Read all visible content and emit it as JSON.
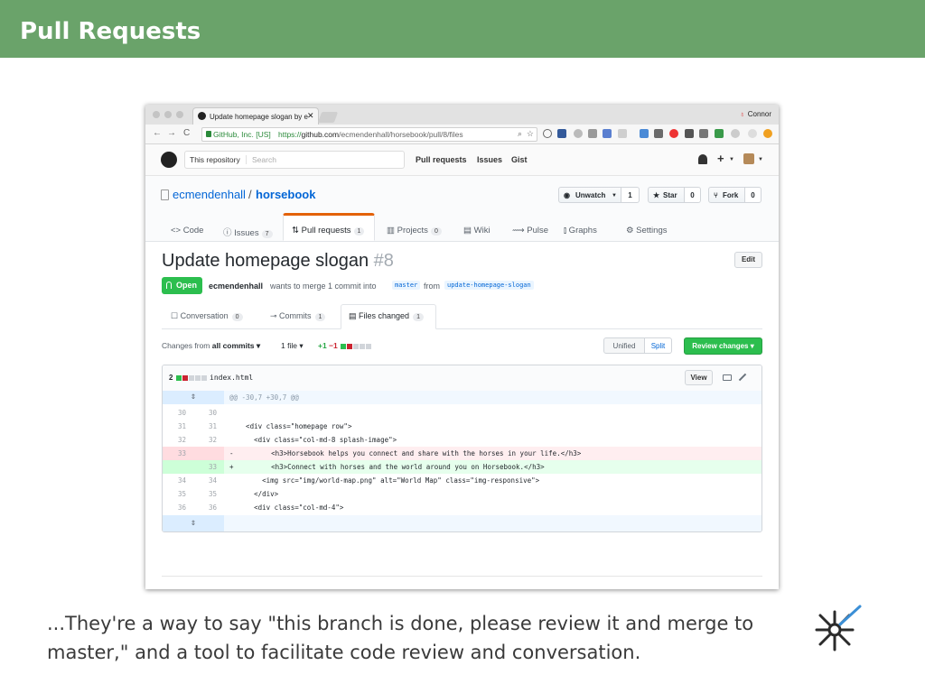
{
  "slide": {
    "title": "Pull Requests",
    "caption": "...They're a way to say \"this branch is done, please review it and merge to master,\" and a tool to facilitate code review and conversation."
  },
  "browser": {
    "tab_title": "Update homepage slogan by e",
    "tab_close": "✕",
    "user_name": "Connor",
    "back": "←",
    "forward": "→",
    "reload": "C",
    "secure_label": "GitHub, Inc. [US]",
    "url_scheme": "https://",
    "url_host": "github.com",
    "url_path": "/ecmendenhall/horsebook/pull/8/files"
  },
  "github": {
    "scope_label": "This repository",
    "search_placeholder": "Search",
    "nav": [
      "Pull requests",
      "Issues",
      "Gist"
    ],
    "plus": "+"
  },
  "repo": {
    "owner": "ecmendenhall",
    "separator": "/",
    "name": "horsebook",
    "watch_label": "Unwatch",
    "watch_count": "1",
    "star_label": "Star",
    "star_count": "0",
    "fork_label": "Fork",
    "fork_count": "0",
    "tabs": [
      {
        "label": "<> Code",
        "count": ""
      },
      {
        "label": "ⓘ Issues",
        "count": "7"
      },
      {
        "label": "Pull requests",
        "count": "1"
      },
      {
        "label": "▥ Projects",
        "count": "0"
      },
      {
        "label": "▤ Wiki",
        "count": ""
      },
      {
        "label": "⟿ Pulse",
        "count": ""
      },
      {
        "label": "⫾ Graphs",
        "count": ""
      },
      {
        "label": "⚙ Settings",
        "count": ""
      }
    ]
  },
  "pr": {
    "title": "Update homepage slogan",
    "number": "#8",
    "edit_label": "Edit",
    "state": "Open",
    "author": "ecmendenhall",
    "meta_text": "wants to merge 1 commit into",
    "base_branch": "master",
    "from_text": "from",
    "head_branch": "update-homepage-slogan",
    "tabs": [
      {
        "label": "Conversation",
        "count": "0"
      },
      {
        "label": "Commits",
        "count": "1"
      },
      {
        "label": "Files changed",
        "count": "1"
      }
    ]
  },
  "files_toolbar": {
    "changes_prefix": "Changes from",
    "changes_value": "all commits ▾",
    "file_count": "1 file ▾",
    "additions": "+1",
    "deletions": "−1",
    "unified": "Unified",
    "split": "Split",
    "review_button": "Review changes ▾"
  },
  "diff": {
    "change_count": "2",
    "filename": "index.html",
    "view_label": "View",
    "hunk_header": "@@ -30,7 +30,7 @@",
    "expander": "⇕",
    "lines": [
      {
        "old": "30",
        "new": "30",
        "marker": "",
        "text": ""
      },
      {
        "old": "31",
        "new": "31",
        "marker": "",
        "text": "    <div class=\"homepage row\">"
      },
      {
        "old": "32",
        "new": "32",
        "marker": "",
        "text": "      <div class=\"col-md-8 splash-image\">"
      },
      {
        "old": "33",
        "new": "",
        "marker": "-",
        "text": "        <h3>Horsebook helps you connect and share with the horses in your life.</h3>"
      },
      {
        "old": "",
        "new": "33",
        "marker": "+",
        "text": "        <h3>Connect with horses and the world around you on Horsebook.</h3>"
      },
      {
        "old": "34",
        "new": "34",
        "marker": "",
        "text": "        <img src=\"img/world-map.png\" alt=\"World Map\" class=\"img-responsive\">"
      },
      {
        "old": "35",
        "new": "35",
        "marker": "",
        "text": "      </div>"
      },
      {
        "old": "36",
        "new": "36",
        "marker": "",
        "text": "      <div class=\"col-md-4\">"
      }
    ]
  },
  "colors": {
    "header_green": "#6aa36a",
    "link_blue": "#0366d6",
    "open_green": "#2cbe4e",
    "deletion_red": "#ffeef0",
    "addition_green": "#e6ffed"
  },
  "icons": [
    "github-octocat-icon",
    "bell-icon",
    "plus-icon",
    "eye-icon",
    "star-icon",
    "fork-icon",
    "pull-request-icon",
    "expand-icon",
    "monitor-icon",
    "pencil-icon",
    "starburst-logo-icon"
  ]
}
